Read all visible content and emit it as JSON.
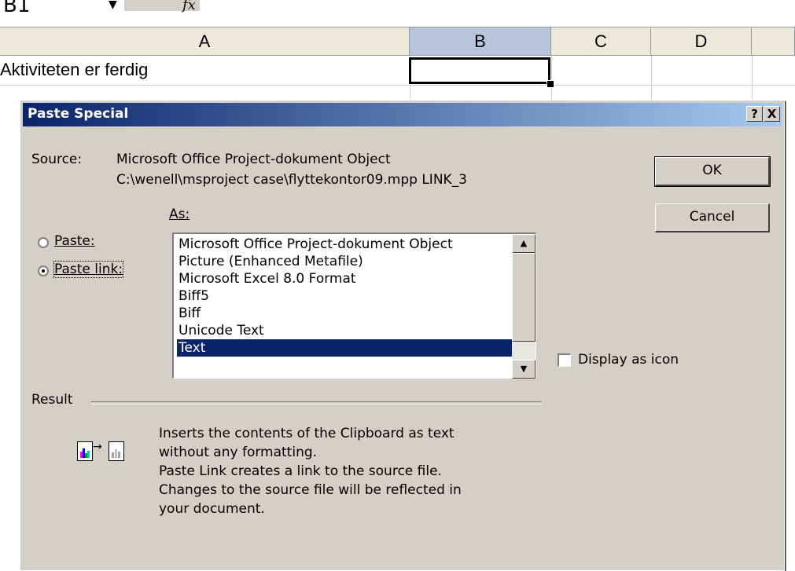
{
  "spreadsheet": {
    "namebox": "B1",
    "fx_label": "fx",
    "columns": [
      "A",
      "B",
      "C",
      "D"
    ],
    "cell_a1": "Aktiviteten er ferdig"
  },
  "dialog": {
    "title": "Paste Special",
    "help_btn": "?",
    "close_btn": "X",
    "source_label": "Source:",
    "source_line1": "Microsoft Office Project-dokument Object",
    "source_line2": "C:\\wenell\\msproject case\\flyttekontor09.mpp LINK_3",
    "as_label": "As:",
    "paste_label": "Paste:",
    "paste_link_label": "Paste link:",
    "ok_label": "OK",
    "cancel_label": "Cancel",
    "formats": [
      "Microsoft Office Project-dokument Object",
      "Picture (Enhanced Metafile)",
      "Microsoft Excel 8.0 Format",
      "Biff5",
      "Biff",
      "Unicode Text",
      "Text"
    ],
    "display_as_icon_label": "Display as icon",
    "result_label": "Result",
    "result_lines": [
      "Inserts the contents of the Clipboard as text",
      "without any formatting.",
      "Paste Link creates a link to the source file.",
      "Changes to the source file will be reflected in",
      "your document."
    ]
  }
}
